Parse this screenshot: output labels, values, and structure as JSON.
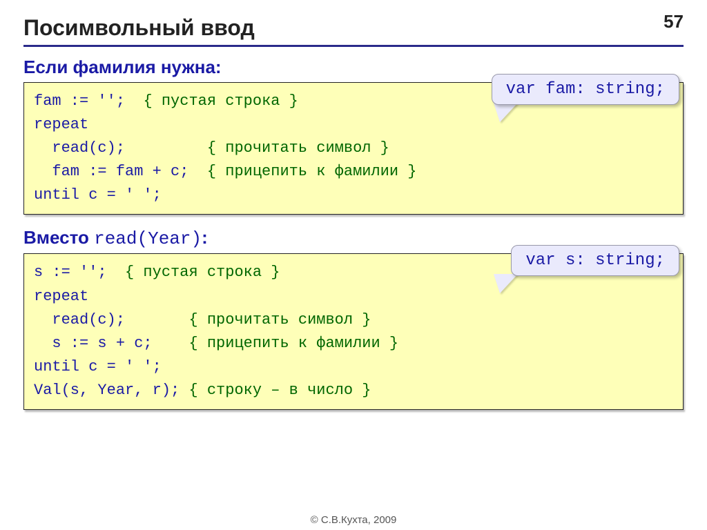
{
  "page_number": "57",
  "title": "Посимвольный ввод",
  "section1": {
    "label": "Если фамилия нужна:",
    "callout": "var fam: string;",
    "code": {
      "l1a": "fam := '';  ",
      "l1b": "{ пустая строка }",
      "l2a": "repeat",
      "l3a": "  read(c);         ",
      "l3b": "{ прочитать символ }",
      "l4a": "  fam := fam + c;  ",
      "l4b": "{ прицепить к фамилии }",
      "l5a": "until c = ' ';"
    }
  },
  "section2": {
    "label_prefix": "Вместо ",
    "label_code": "read(Year)",
    "label_suffix": ":",
    "callout": "var s: string;",
    "code": {
      "l1a": "s := '';  ",
      "l1b": "{ пустая строка }",
      "l2a": "repeat",
      "l3a": "  read(c);       ",
      "l3b": "{ прочитать символ }",
      "l4a": "  s := s + c;    ",
      "l4b": "{ прицепить к фамилии }",
      "l5a": "until c = ' ';",
      "l6a": "Val(s, Year, r); ",
      "l6b": "{ строку – в число }"
    }
  },
  "footer": "© С.В.Кухта, 2009"
}
